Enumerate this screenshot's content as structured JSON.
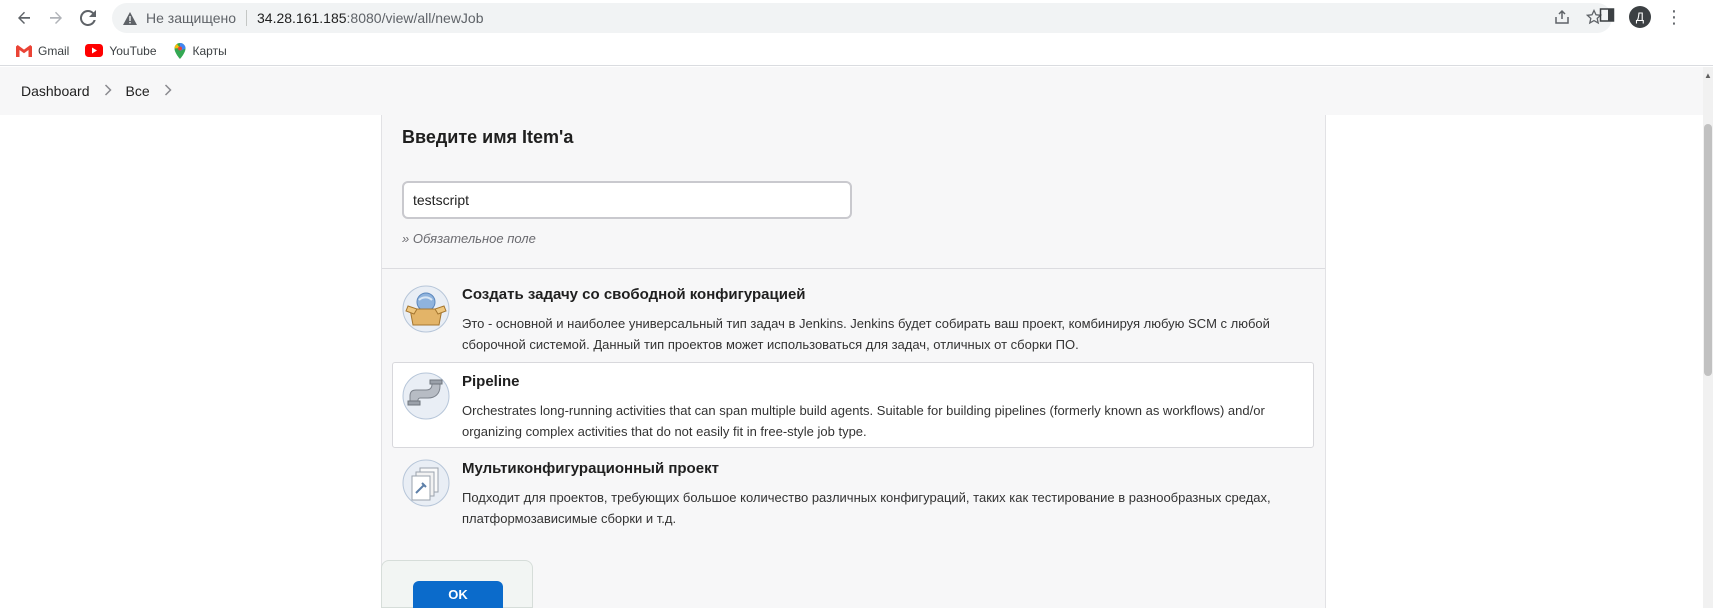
{
  "browser": {
    "security_label": "Не защищено",
    "url_host": "34.28.161.185",
    "url_rest": ":8080/view/all/newJob",
    "profile_initial": "Д",
    "bookmarks": [
      {
        "label": "Gmail",
        "icon": "gmail-icon"
      },
      {
        "label": "YouTube",
        "icon": "youtube-icon"
      },
      {
        "label": "Карты",
        "icon": "maps-icon"
      }
    ]
  },
  "breadcrumbs": [
    "Dashboard",
    "Все"
  ],
  "form": {
    "title": "Введите имя Item'a",
    "name_value": "testscript",
    "required_hint": "» Обязательное поле"
  },
  "items": [
    {
      "title": "Создать задачу со свободной конфигурацией",
      "description": "Это - основной и наиболее универсальный тип задач в Jenkins. Jenkins будет собирать ваш проект, комбинируя любую SCM с любой сборочной системой. Данный тип проектов может использоваться для задач, отличных от сборки ПО.",
      "icon": "freestyle-box-icon",
      "selected": false
    },
    {
      "title": "Pipeline",
      "description": "Orchestrates long-running activities that can span multiple build agents. Suitable for building pipelines (formerly known as workflows) and/or organizing complex activities that do not easily fit in free-style job type.",
      "icon": "pipeline-icon",
      "selected": true
    },
    {
      "title": "Мультиконфигурационный проект",
      "description": "Подходит для проектов, требующих большое количество различных конфигураций, таких как тестирование в разнообразных средах, платформозависимые сборки и т.д.",
      "icon": "multiconfig-icon",
      "selected": false
    }
  ],
  "ok_button": "OK",
  "colors": {
    "primary_button": "#0b6bcb",
    "panel_bg": "#f7f7f8"
  }
}
